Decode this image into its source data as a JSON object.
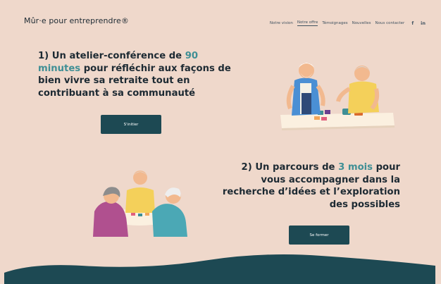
{
  "header": {
    "logo": "Mûr·e pour entreprendre®",
    "nav": [
      "Notre vision",
      "Notre offre",
      "Témoignages",
      "Nouvelles",
      "Nous contacter"
    ],
    "social": [
      "f",
      "in"
    ]
  },
  "section1": {
    "title_part1": "1) Un atelier-conférence de ",
    "title_highlight": "90 minutes",
    "title_part2": " pour réfléchir aux façons de bien vivre sa retraite tout en contribuant à sa communauté",
    "button_label": "S'initier"
  },
  "section2": {
    "title_part1": "2) Un parcours de ",
    "title_highlight": "3 mois",
    "title_part2": " pour vous accompagner dans la recherche d’idées et l’exploration des possibles",
    "button_label": "Se former"
  },
  "colors": {
    "background": "#efd8cb",
    "accent": "#3f8f95",
    "button": "#1d4953",
    "footer_wave": "#1d4953"
  }
}
